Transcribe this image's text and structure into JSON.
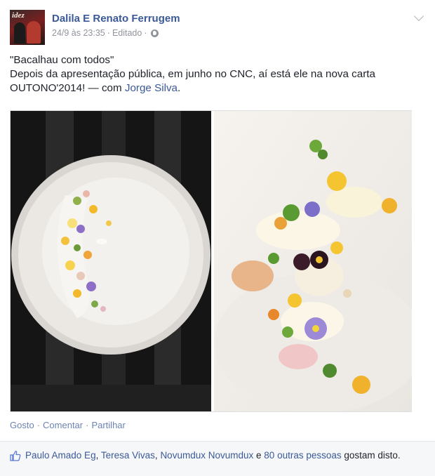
{
  "post": {
    "author": "Dalila E Renato Ferrugem",
    "avatar_text": "idez",
    "timestamp": "24/9 às 23:35",
    "edited_label": "Editado",
    "dot1": "·",
    "dot2": "·",
    "privacy_icon": "globe-icon",
    "menu_icon": "chevron-down-icon",
    "text_line1": "\"Bacalhau com todos\"",
    "text_line2": "Depois da apresentação pública, em junho no CNC, aí está ele na nova carta OUTONO'2014!",
    "with_prefix": "— com",
    "tagged_person": "Jorge Silva",
    "tagged_suffix": "."
  },
  "actions": {
    "like": "Gosto",
    "sep1": "·",
    "comment": "Comentar",
    "sep2": "·",
    "share": "Partilhar"
  },
  "likes": {
    "icon": "thumbs-up-icon",
    "person1": "Paulo Amado Eg",
    "comma1": ",",
    "person2": "Teresa Vivas",
    "comma2": ",",
    "person3": "Novumdux Novumdux",
    "and": "e",
    "others": "80 outras pessoas",
    "suffix": "gostam disto."
  },
  "colors": {
    "link": "#3b5998",
    "action_link": "#6d84b4",
    "meta": "#90949c",
    "text": "#1d2129"
  }
}
